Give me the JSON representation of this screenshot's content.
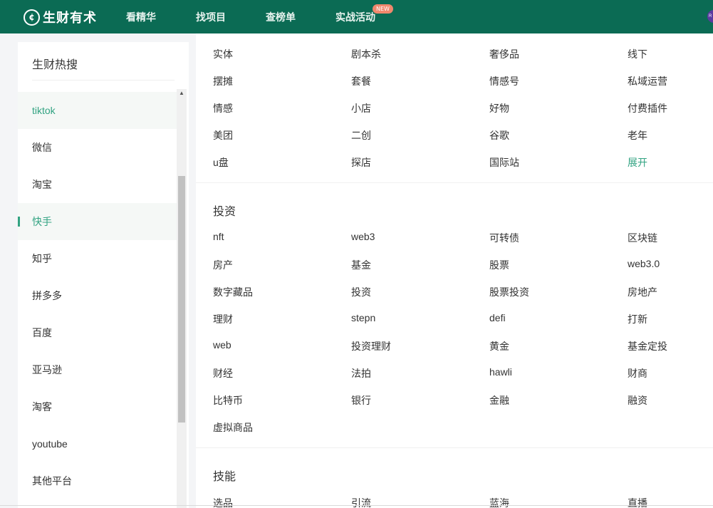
{
  "header": {
    "logo_mark": "¢",
    "logo_text": "生财有术",
    "nav": [
      "看精华",
      "找项目",
      "查榜单",
      "实战活动"
    ],
    "new_badge": "NEW",
    "avatar_text": "R"
  },
  "sidebar": {
    "title": "生财热搜",
    "items": [
      "tiktok",
      "微信",
      "淘宝",
      "快手",
      "知乎",
      "拼多多",
      "百度",
      "亚马逊",
      "淘客",
      "youtube",
      "其他平台"
    ]
  },
  "main": {
    "top_rows": [
      [
        "实体",
        "剧本杀",
        "奢侈品",
        "线下"
      ],
      [
        "摆摊",
        "套餐",
        "情感号",
        "私域运营"
      ],
      [
        "情感",
        "小店",
        "好物",
        "付费插件"
      ],
      [
        "美团",
        "二创",
        "谷歌",
        "老年"
      ],
      [
        "u盘",
        "探店",
        "国际站",
        "展开"
      ]
    ],
    "sections": [
      {
        "title": "投资",
        "rows": [
          [
            "nft",
            "web3",
            "可转债",
            "区块链"
          ],
          [
            "房产",
            "基金",
            "股票",
            "web3.0"
          ],
          [
            "数字藏品",
            "投资",
            "股票投资",
            "房地产"
          ],
          [
            "理财",
            "stepn",
            "defi",
            "打新"
          ],
          [
            "web",
            "投资理财",
            "黄金",
            "基金定投"
          ],
          [
            "财经",
            "法拍",
            "hawli",
            "财商"
          ],
          [
            "比特币",
            "银行",
            "金融",
            "融资"
          ],
          [
            "虚拟商品"
          ]
        ]
      },
      {
        "title": "技能",
        "rows": [
          [
            "选品",
            "引流",
            "蓝海",
            "直播"
          ]
        ]
      }
    ]
  },
  "colors": {
    "header_bg": "#0b6b54",
    "accent": "#32a382",
    "badge": "#f0886d"
  }
}
